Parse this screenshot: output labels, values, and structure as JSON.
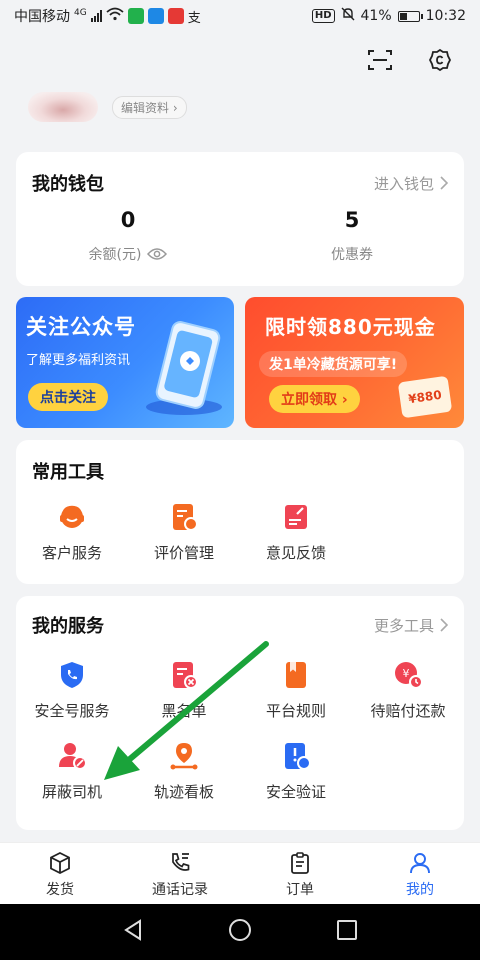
{
  "status_bar": {
    "carrier": "中国移动",
    "network": "4G",
    "hd": "HD",
    "battery": "41%",
    "battery_level": 0.41,
    "time": "10:32",
    "extra_glyph": "支"
  },
  "profile": {
    "edit_label": "编辑资料"
  },
  "wallet": {
    "title": "我的钱包",
    "enter_label": "进入钱包",
    "balance_value": "0",
    "balance_label": "余额(元)",
    "coupon_value": "5",
    "coupon_label": "优惠券"
  },
  "banners": {
    "left": {
      "title": "关注公众号",
      "subtitle": "了解更多福利资讯",
      "button": "点击关注"
    },
    "right": {
      "title": "限时领880元现金",
      "subtitle": "发1单冷藏货源可享!",
      "button": "立即领取 ›",
      "sticker": "¥880"
    }
  },
  "tools": {
    "title": "常用工具",
    "items": [
      {
        "label": "客户服务",
        "icon": "headset-icon"
      },
      {
        "label": "评价管理",
        "icon": "rating-icon"
      },
      {
        "label": "意见反馈",
        "icon": "feedback-icon"
      }
    ]
  },
  "services": {
    "title": "我的服务",
    "more_label": "更多工具",
    "items": [
      {
        "label": "安全号服务",
        "icon": "shield-phone-icon"
      },
      {
        "label": "黑名单",
        "icon": "blacklist-icon"
      },
      {
        "label": "平台规则",
        "icon": "rules-book-icon"
      },
      {
        "label": "待赔付还款",
        "icon": "repayment-clock-icon"
      },
      {
        "label": "屏蔽司机",
        "icon": "block-driver-icon"
      },
      {
        "label": "轨迹看板",
        "icon": "track-icon"
      },
      {
        "label": "安全验证",
        "icon": "verify-icon"
      }
    ]
  },
  "bottom_nav": {
    "items": [
      {
        "label": "发货",
        "icon": "box-icon"
      },
      {
        "label": "通话记录",
        "icon": "call-log-icon"
      },
      {
        "label": "订单",
        "icon": "clipboard-icon"
      },
      {
        "label": "我的",
        "icon": "person-icon"
      }
    ]
  },
  "colors": {
    "primary": "#2a6bf3",
    "accent_orange": "#f46a21",
    "accent_red": "#ef4453",
    "highlight_arrow": "#1aa33a"
  }
}
